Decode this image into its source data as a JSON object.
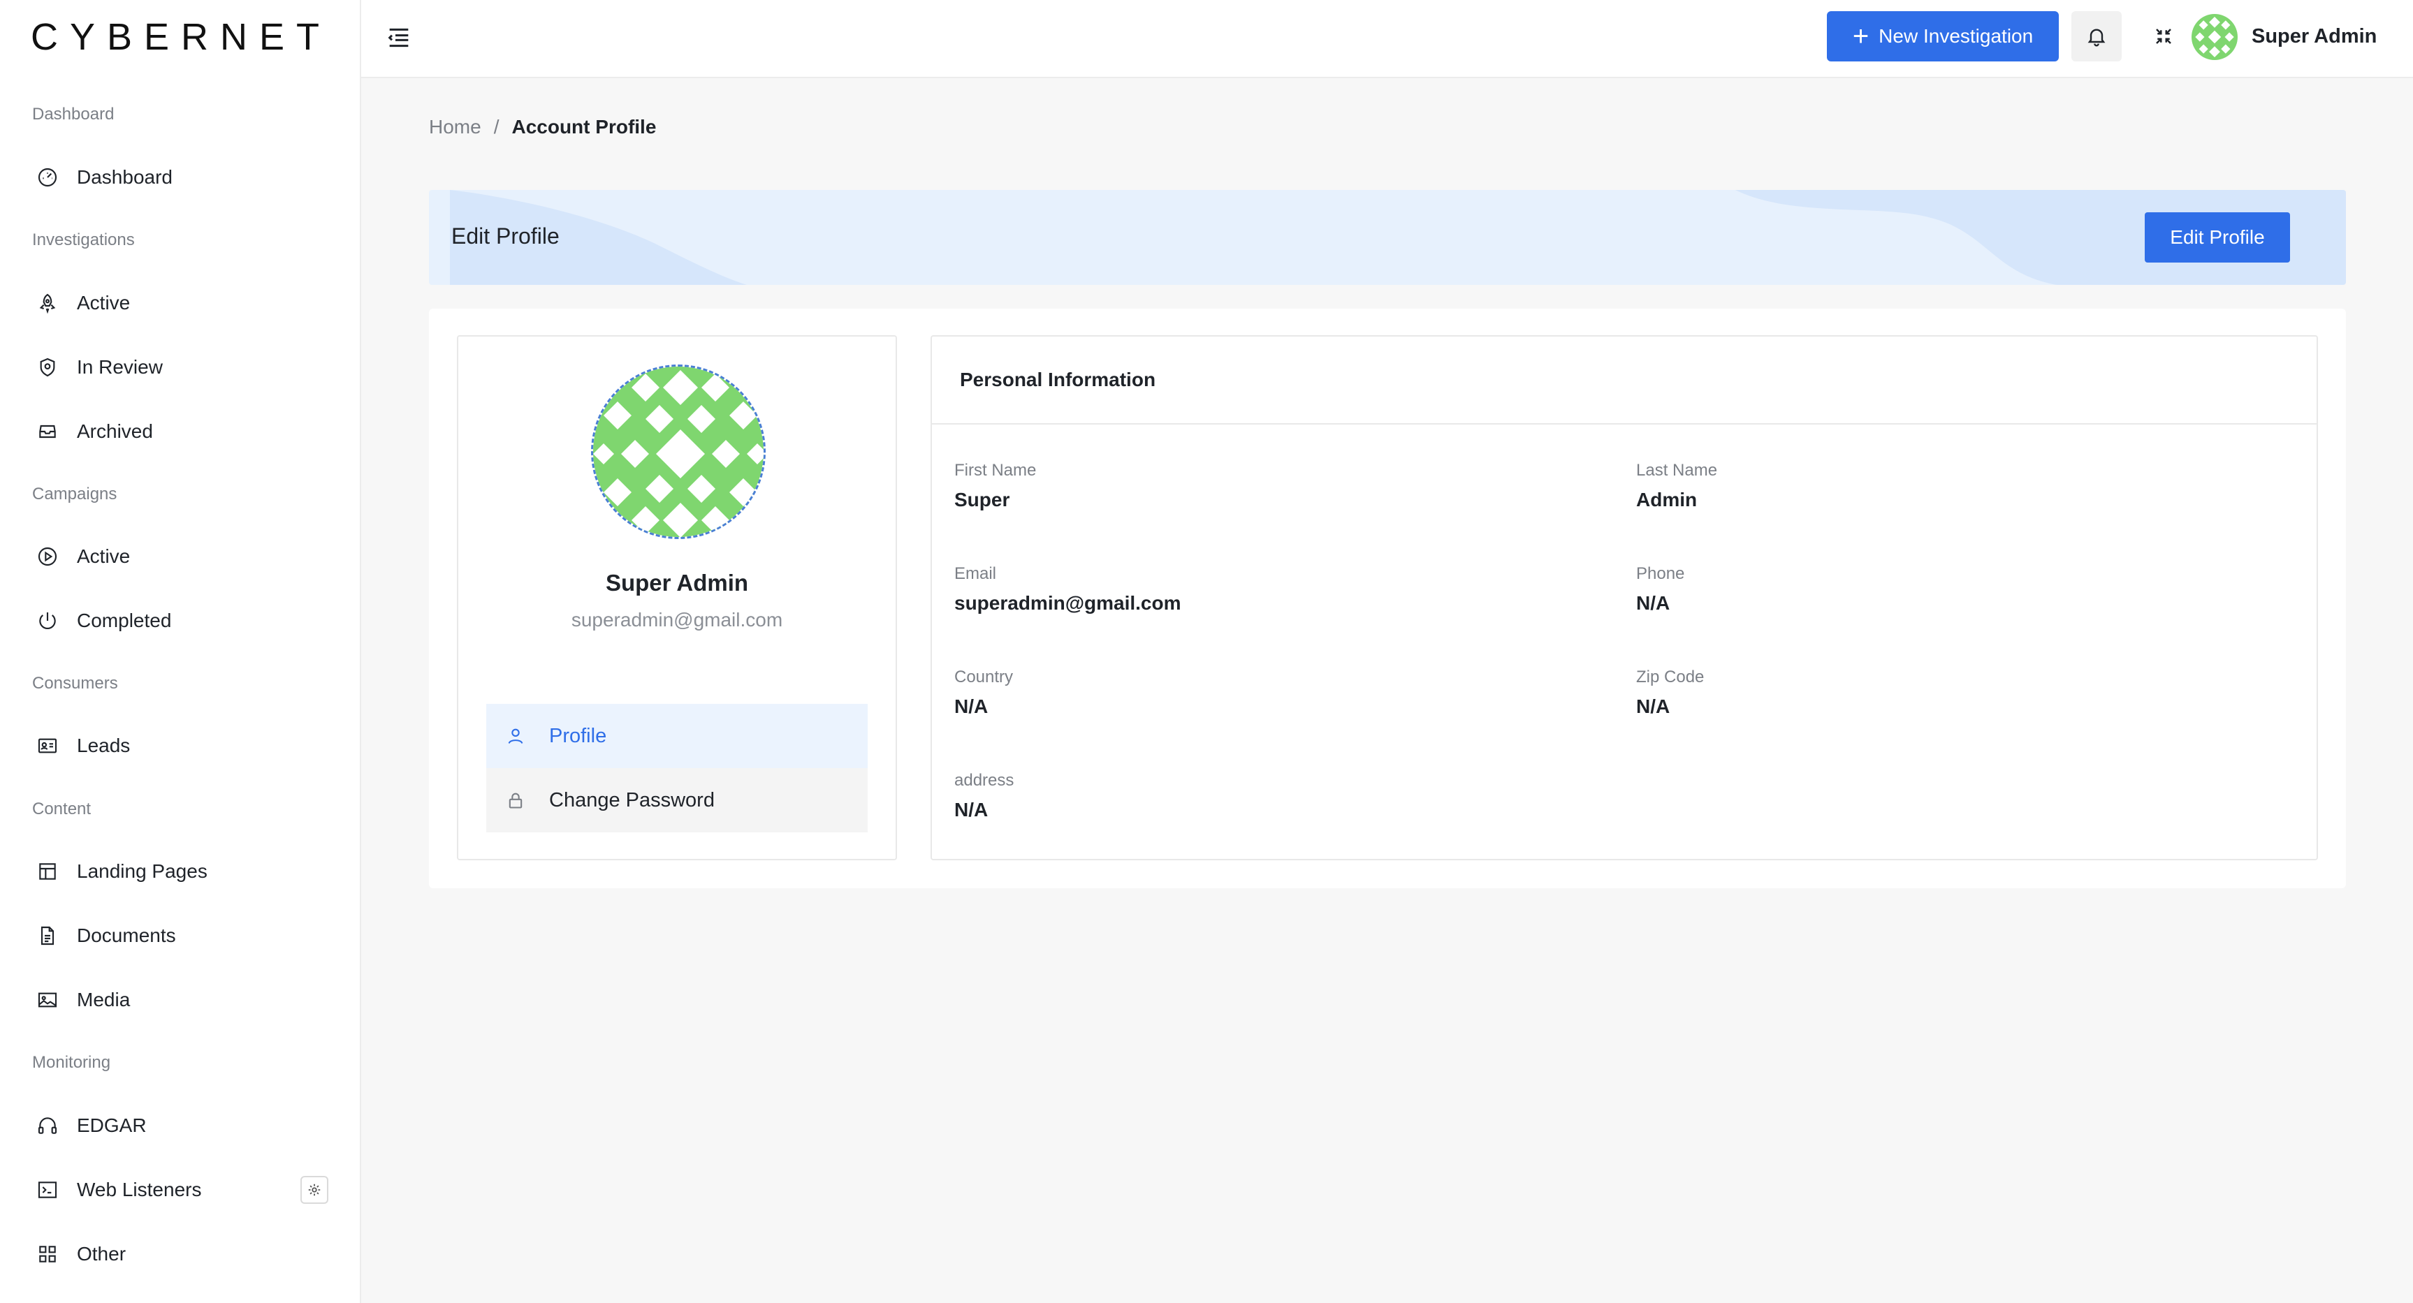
{
  "brand": {
    "logo_text": "CYBERNET"
  },
  "sidebar": {
    "sections": [
      {
        "title": "Dashboard",
        "items": [
          {
            "label": "Dashboard",
            "icon": "speedometer-icon"
          }
        ]
      },
      {
        "title": "Investigations",
        "items": [
          {
            "label": "Active",
            "icon": "rocket-icon"
          },
          {
            "label": "In Review",
            "icon": "shield-icon"
          },
          {
            "label": "Archived",
            "icon": "inbox-icon"
          }
        ]
      },
      {
        "title": "Campaigns",
        "items": [
          {
            "label": "Active",
            "icon": "play-circle-icon"
          },
          {
            "label": "Completed",
            "icon": "power-icon"
          }
        ]
      },
      {
        "title": "Consumers",
        "items": [
          {
            "label": "Leads",
            "icon": "id-card-icon"
          }
        ]
      },
      {
        "title": "Content",
        "items": [
          {
            "label": "Landing Pages",
            "icon": "layout-icon"
          },
          {
            "label": "Documents",
            "icon": "document-icon"
          },
          {
            "label": "Media",
            "icon": "image-icon"
          }
        ]
      },
      {
        "title": "Monitoring",
        "items": [
          {
            "label": "EDGAR",
            "icon": "headphones-icon"
          },
          {
            "label": "Web Listeners",
            "icon": "terminal-icon"
          },
          {
            "label": "Other",
            "icon": "grid-icon"
          }
        ]
      }
    ]
  },
  "topbar": {
    "new_button_label": "New Investigation",
    "user_name": "Super Admin"
  },
  "breadcrumb": {
    "home": "Home",
    "separator": "/",
    "current": "Account Profile"
  },
  "banner": {
    "title": "Edit Profile",
    "button_label": "Edit Profile"
  },
  "profile": {
    "name": "Super Admin",
    "email": "superadmin@gmail.com",
    "menu": [
      {
        "label": "Profile",
        "icon": "user-icon"
      },
      {
        "label": "Change Password",
        "icon": "lock-icon"
      }
    ]
  },
  "personal_info": {
    "title": "Personal Information",
    "fields": {
      "first_name": {
        "label": "First Name",
        "value": "Super"
      },
      "last_name": {
        "label": "Last Name",
        "value": "Admin"
      },
      "email": {
        "label": "Email",
        "value": "superadmin@gmail.com"
      },
      "phone": {
        "label": "Phone",
        "value": "N/A"
      },
      "country": {
        "label": "Country",
        "value": "N/A"
      },
      "zip": {
        "label": "Zip Code",
        "value": "N/A"
      },
      "address": {
        "label": "address",
        "value": "N/A"
      }
    }
  },
  "colors": {
    "accent": "#2f6ee8",
    "avatar_green": "#7fd66f",
    "banner_bg": "#e7f1fd"
  }
}
